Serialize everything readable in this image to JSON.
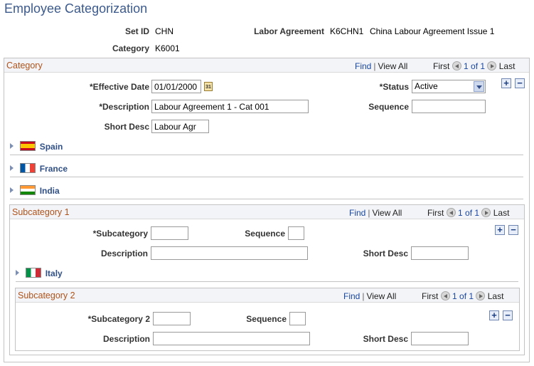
{
  "page": {
    "title": "Employee Categorization"
  },
  "header": {
    "setid_label": "Set ID",
    "setid_value": "CHN",
    "labor_label": "Labor Agreement",
    "labor_value": "K6CHN1",
    "labor_desc": "China Labour Agreement Issue 1",
    "category_label": "Category",
    "category_value": "K6001"
  },
  "category": {
    "title": "Category",
    "find": "Find",
    "view_all": "View All",
    "first": "First",
    "count": "1 of 1",
    "last": "Last",
    "effdt_label": "*Effective Date",
    "effdt_value": "01/01/2000",
    "status_label": "*Status",
    "status_value": "Active",
    "descr_label": "*Description",
    "descr_value": "Labour Agreement 1 - Cat 001",
    "sequence_label": "Sequence",
    "sequence_value": "",
    "shortdesc_label": "Short Desc",
    "shortdesc_value": "Labour Agr",
    "countries": [
      "Spain",
      "France",
      "India"
    ]
  },
  "subcat1": {
    "title": "Subcategory 1",
    "find": "Find",
    "view_all": "View All",
    "first": "First",
    "count": "1 of 1",
    "last": "Last",
    "subcat_label": "*Subcategory",
    "subcat_value": "",
    "sequence_label": "Sequence",
    "sequence_value": "",
    "descr_label": "Description",
    "descr_value": "",
    "shortdesc_label": "Short Desc",
    "shortdesc_value": "",
    "country": "Italy"
  },
  "subcat2": {
    "title": "Subcategory 2",
    "find": "Find",
    "view_all": "View All",
    "first": "First",
    "count": "1 of 1",
    "last": "Last",
    "subcat_label": "*Subcategory 2",
    "subcat_value": "",
    "sequence_label": "Sequence",
    "sequence_value": "",
    "descr_label": "Description",
    "descr_value": "",
    "shortdesc_label": "Short Desc",
    "shortdesc_value": ""
  },
  "icons": {
    "add": "+",
    "delete": "−",
    "calendar": "31"
  },
  "colors": {
    "title": "#3c5a8c",
    "section_title": "#b0531b",
    "link": "#1a47a0"
  }
}
